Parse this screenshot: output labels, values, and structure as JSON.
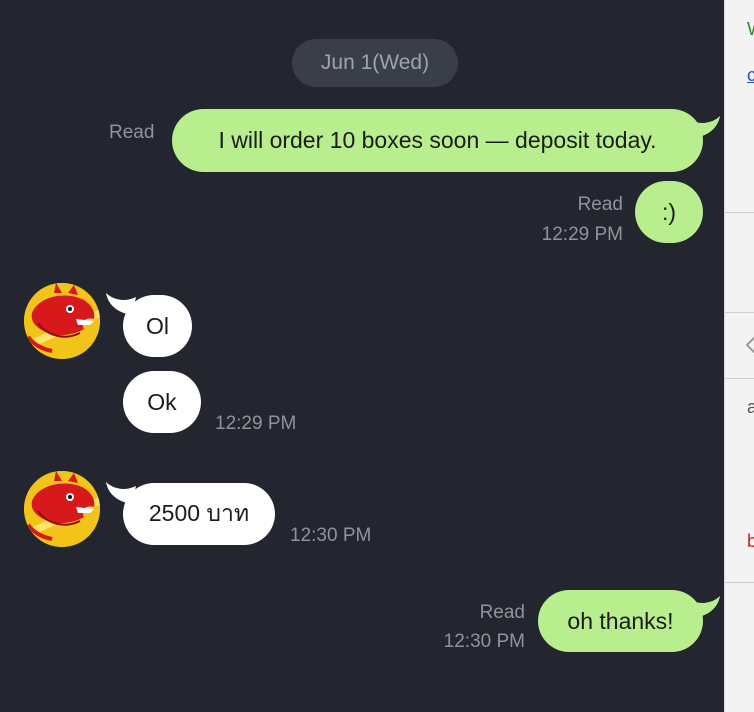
{
  "chat": {
    "date_label": "Jun 1(Wed)",
    "messages": [
      {
        "direction": "outgoing",
        "text": "I will order 10 boxes soon — deposit today.",
        "status": "Read",
        "time": ""
      },
      {
        "direction": "outgoing",
        "text": ":)",
        "status": "Read",
        "time": "12:29 PM"
      },
      {
        "direction": "incoming",
        "text": "Ol",
        "time": ""
      },
      {
        "direction": "incoming",
        "text": "Ok",
        "time": "12:29 PM"
      },
      {
        "direction": "incoming",
        "text": "2500 บาท",
        "time": "12:30 PM"
      },
      {
        "direction": "outgoing",
        "text": "oh thanks!",
        "status": "Read",
        "time": "12:30 PM"
      }
    ]
  },
  "contact": {
    "avatar_icon": "dragon-avatar-icon"
  },
  "colors": {
    "background": "#23262e",
    "outgoing_bubble": "#b8ee8d",
    "incoming_bubble": "#ffffff",
    "meta_text": "#8e939c",
    "date_pill": "#3a3e47"
  },
  "edge_strip": {
    "glyphs": [
      "W",
      "c",
      "a",
      "b"
    ]
  }
}
